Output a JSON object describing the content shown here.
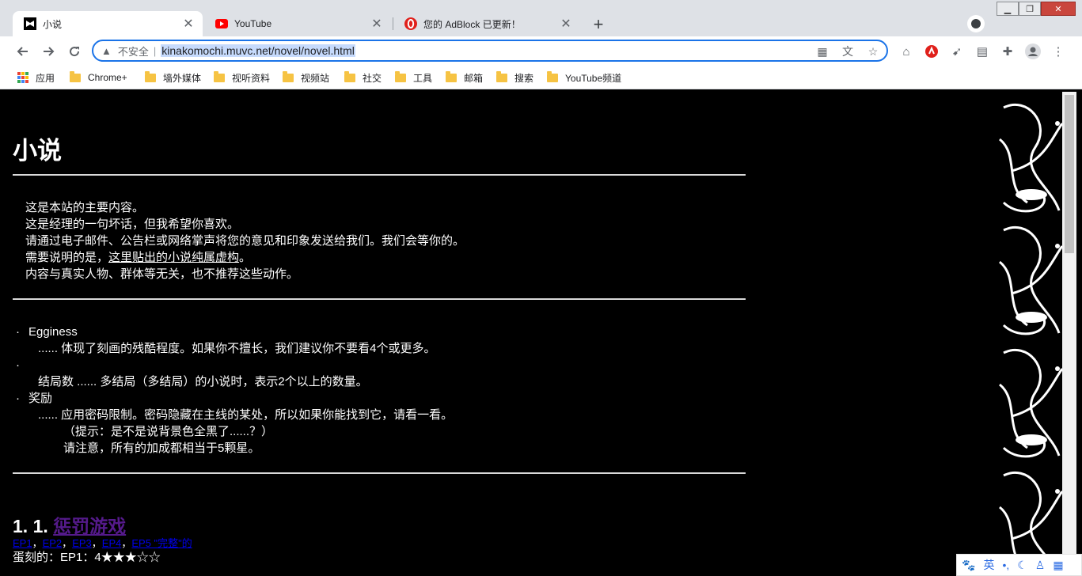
{
  "browser": {
    "tabs": [
      {
        "title": "小说",
        "close": "✕",
        "active": true
      },
      {
        "title": "YouTube",
        "close": "✕",
        "active": false
      },
      {
        "title": "您的 AdBlock 已更新！",
        "close": "✕",
        "active": false
      }
    ],
    "new_tab": "+",
    "address": {
      "security_label": "不安全",
      "url": "kinakomochi.muvc.net/novel/novel.html"
    },
    "bookmarks": [
      "应用",
      "Chrome+",
      "墙外媒体",
      "视听资料",
      "视频站",
      "社交",
      "工具",
      "邮箱",
      "搜索",
      "YouTube频道"
    ]
  },
  "page": {
    "title": "小说",
    "intro": [
      "这是本站的主要内容。",
      "这是经理的一句坏话，但我希望你喜欢。",
      "请通过电子邮件、公告栏或网络掌声将您的意见和印象发送给我们。我们会等你的。",
      "需要说明的是，这里贴出的小说纯属虚构。",
      "内容与真实人物、群体等无关，也不推荐这些动作。"
    ],
    "intro_link_prefix": "需要说明的是，",
    "intro_link": "这里贴出的小说纯属虚构",
    "intro_link_suffix": "。",
    "legend": {
      "bullet": "·",
      "egginess_label": "Egginess",
      "egginess_desc": "...... 体现了刻画的残酷程度。如果你不擅长，我们建议你不要看4个或更多。",
      "endings_desc": "结局数 ...... 多结局（多结局）的小说时，表示2个以上的数量。",
      "bonus_label": "奖励",
      "bonus_desc": "...... 应用密码限制。密码隐藏在主线的某处，所以如果你能找到它，请看一看。",
      "bonus_hint": "（提示：是不是说背景色全黑了......？）",
      "bonus_note": "请注意，所有的加成都相当于5颗星。"
    },
    "novels": [
      {
        "number": "1. 1.",
        "title": "惩罚游戏",
        "episodes": [
          "EP1",
          "EP2",
          "EP3",
          "EP4",
          "EP5 \"完整\"的"
        ],
        "separator": "，",
        "rating": "蛋刻的：EP1：4★★★☆☆"
      }
    ]
  },
  "ime": {
    "lang": "英"
  },
  "colors": {
    "visited_link": "#551a8b",
    "link": "#0000ee",
    "accent": "#1a73e8"
  }
}
